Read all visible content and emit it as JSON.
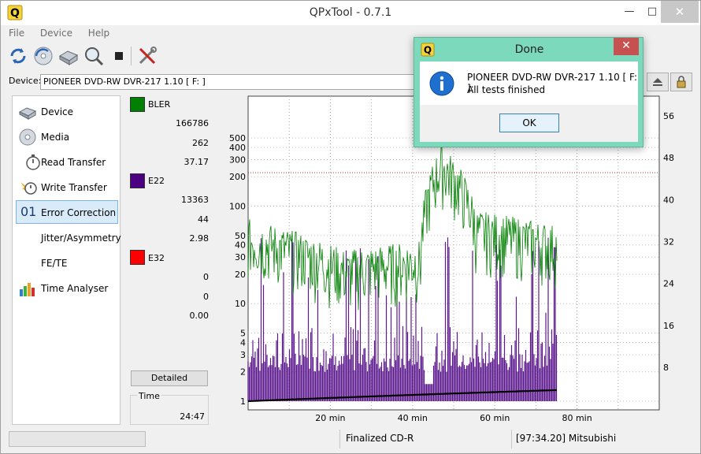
{
  "window": {
    "title": "QPxTool - 0.7.1",
    "app_icon_letter": "Q"
  },
  "menu": [
    "File",
    "Device",
    "Help"
  ],
  "toolbar": {
    "buttons": [
      "refresh-icon",
      "reload-media-icon",
      "scan-device-icon",
      "search-icon",
      "stop-icon",
      "tools-icon"
    ]
  },
  "device": {
    "label": "Device:",
    "value": "PIONEER  DVD-RW  DVR-217  1.10 [ F: ]"
  },
  "nav": {
    "items": [
      {
        "label": "Device"
      },
      {
        "label": "Media"
      },
      {
        "label": "Read Transfer"
      },
      {
        "label": "Write Transfer"
      },
      {
        "label": "Error Correction",
        "num": "01"
      },
      {
        "label": "Jitter/Asymmetry"
      },
      {
        "label": "FE/TE"
      },
      {
        "label": "Time Analyser"
      }
    ]
  },
  "stats": {
    "bler": {
      "label": "BLER",
      "color": "#008000",
      "values": [
        "166786",
        "262",
        "37.17"
      ]
    },
    "e22": {
      "label": "E22",
      "color": "#4b0082",
      "values": [
        "13363",
        "44",
        "2.98"
      ]
    },
    "e32": {
      "label": "E32",
      "color": "#ff0000",
      "values": [
        "0",
        "0",
        "0.00"
      ]
    },
    "detailed_label": "Detailed",
    "time_label": "Time",
    "time_value": "24:47"
  },
  "chart_data": {
    "type": "line",
    "log_scale_left": true,
    "left_ticks": [
      "1",
      "2",
      "3",
      "4",
      "5",
      "10",
      "20",
      "30",
      "40",
      "50",
      "100",
      "200",
      "300",
      "400",
      "500"
    ],
    "right_ticks": [
      "8",
      "16",
      "24",
      "32",
      "40",
      "48",
      "56"
    ],
    "x_ticks": [
      "20 min",
      "40 min",
      "60 min",
      "80 min"
    ],
    "xlim": [
      0,
      100
    ],
    "series": [
      {
        "color": "#008000"
      },
      {
        "color": "#4b0082"
      },
      {
        "color": "#000000"
      }
    ],
    "grid": true
  },
  "status": {
    "left": "",
    "middle": "Finalized CD-R",
    "right": "[97:34.20] Mitsubishi"
  },
  "dialog": {
    "title": "Done",
    "message1": "PIONEER  DVD-RW  DVR-217  1.10 [ F: ]:",
    "message2": "All tests finished",
    "ok_label": "OK"
  }
}
